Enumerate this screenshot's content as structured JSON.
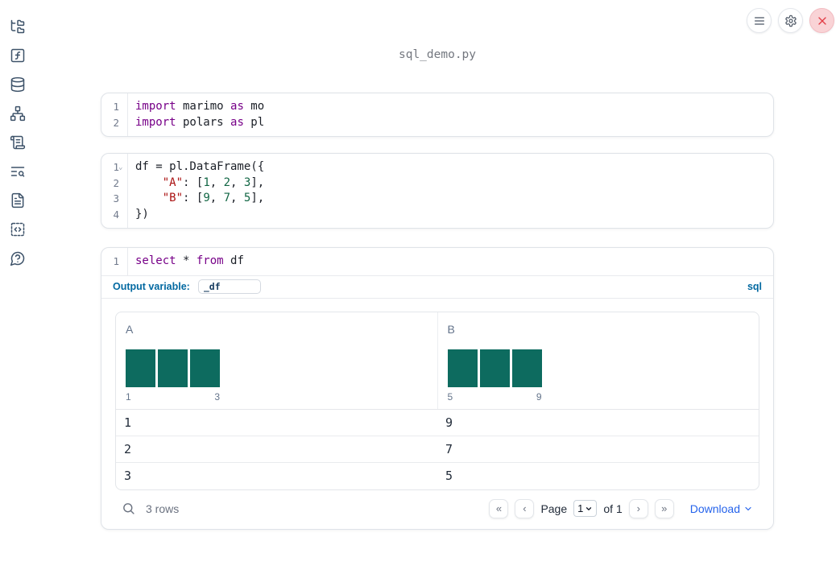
{
  "window": {
    "title": "sql_demo.py"
  },
  "topbar": {
    "icons": [
      "menu",
      "settings",
      "close"
    ]
  },
  "sidebar": {
    "icons": [
      "file-tree",
      "functions",
      "database",
      "dependency-graph",
      "scroll",
      "list-search",
      "document",
      "snippets",
      "help"
    ]
  },
  "colors": {
    "hist_bar": "#0d6b5f",
    "accent_blue": "#0369a1",
    "download_blue": "#2563eb",
    "keyword": "#770088",
    "string": "#aa1111",
    "number": "#116644",
    "close_red": "#e23c45"
  },
  "cells": [
    {
      "lines": [
        {
          "n": "1",
          "fold": "",
          "seg": [
            [
              "kw",
              "import"
            ],
            [
              "pl",
              " marimo "
            ],
            [
              "kw",
              "as"
            ],
            [
              "pl",
              " mo"
            ]
          ]
        },
        {
          "n": "2",
          "fold": "",
          "seg": [
            [
              "kw",
              "import"
            ],
            [
              "pl",
              " polars "
            ],
            [
              "kw",
              "as"
            ],
            [
              "pl",
              " pl"
            ]
          ]
        }
      ]
    },
    {
      "lines": [
        {
          "n": "1",
          "fold": "⌄",
          "seg": [
            [
              "pl",
              "df = pl.DataFrame({"
            ]
          ]
        },
        {
          "n": "2",
          "fold": "",
          "seg": [
            [
              "pl",
              "    "
            ],
            [
              "str",
              "\"A\""
            ],
            [
              "pl",
              ": ["
            ],
            [
              "num",
              "1"
            ],
            [
              "pl",
              ", "
            ],
            [
              "num",
              "2"
            ],
            [
              "pl",
              ", "
            ],
            [
              "num",
              "3"
            ],
            [
              "pl",
              "],"
            ]
          ]
        },
        {
          "n": "3",
          "fold": "",
          "seg": [
            [
              "pl",
              "    "
            ],
            [
              "str",
              "\"B\""
            ],
            [
              "pl",
              ": ["
            ],
            [
              "num",
              "9"
            ],
            [
              "pl",
              ", "
            ],
            [
              "num",
              "7"
            ],
            [
              "pl",
              ", "
            ],
            [
              "num",
              "5"
            ],
            [
              "pl",
              "],"
            ]
          ]
        },
        {
          "n": "4",
          "fold": "",
          "seg": [
            [
              "pl",
              "})"
            ]
          ]
        }
      ]
    },
    {
      "lines": [
        {
          "n": "1",
          "fold": "",
          "seg": [
            [
              "kw",
              "select"
            ],
            [
              "pl",
              " * "
            ],
            [
              "kw",
              "from"
            ],
            [
              "pl",
              " df"
            ]
          ]
        }
      ]
    }
  ],
  "sql_cell": {
    "output_variable_label": "Output variable:",
    "output_variable_value": "_df",
    "language_badge": "sql"
  },
  "table": {
    "columns": [
      {
        "name": "A",
        "hist_values": [
          1,
          1,
          1
        ],
        "hist_min": "1",
        "hist_max": "3"
      },
      {
        "name": "B",
        "hist_values": [
          1,
          1,
          1
        ],
        "hist_min": "5",
        "hist_max": "9"
      }
    ],
    "rows": [
      [
        "1",
        "9"
      ],
      [
        "2",
        "7"
      ],
      [
        "3",
        "5"
      ]
    ],
    "footer": {
      "row_count": "3 rows",
      "first_glyph": "«",
      "prev_glyph": "‹",
      "page_label": "Page",
      "page_value": "1",
      "of_label": "of 1",
      "next_glyph": "›",
      "last_glyph": "»",
      "download_label": "Download"
    }
  }
}
